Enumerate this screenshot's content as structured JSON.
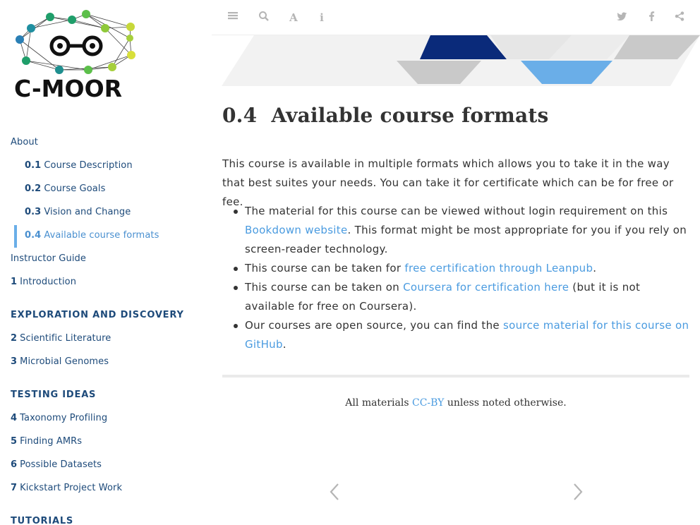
{
  "sidebar": {
    "logo_text": "C-MOOR",
    "items": [
      {
        "num": "",
        "label": "About"
      },
      {
        "num": "0.1",
        "label": "Course Description"
      },
      {
        "num": "0.2",
        "label": "Course Goals"
      },
      {
        "num": "0.3",
        "label": "Vision and Change"
      },
      {
        "num": "0.4",
        "label": "Available course formats"
      },
      {
        "num": "",
        "label": "Instructor Guide"
      },
      {
        "num": "1",
        "label": "Introduction"
      },
      {
        "num": "2",
        "label": "Scientific Literature"
      },
      {
        "num": "3",
        "label": "Microbial Genomes"
      },
      {
        "num": "4",
        "label": "Taxonomy Profiling"
      },
      {
        "num": "5",
        "label": "Finding AMRs"
      },
      {
        "num": "6",
        "label": "Possible Datasets"
      },
      {
        "num": "7",
        "label": "Kickstart Project Work"
      }
    ],
    "headers": [
      "EXPLORATION AND DISCOVERY",
      "TESTING IDEAS",
      "TUTORIALS"
    ]
  },
  "toolbar": {
    "left_icons": [
      "menu-icon",
      "search-icon",
      "font-icon",
      "info-icon"
    ],
    "right_icons": [
      "twitter-icon",
      "facebook-icon",
      "share-icon"
    ]
  },
  "main": {
    "section_number": "0.4",
    "section_title": "Available course formats",
    "intro": "This course is available in multiple formats which allows you to take it in the way that best suites your needs. You can take it for certificate which can be for free or fee.",
    "bullets": [
      {
        "pre": "The material for this course can be viewed without login requirement on this ",
        "link": "Bookdown website",
        "post": ". This format might be most appropriate for you if you rely on screen-reader technology."
      },
      {
        "pre": "This course can be taken for ",
        "link": "free certification through Leanpub",
        "post": "."
      },
      {
        "pre": "This course can be taken on ",
        "link": "Coursera for certification here",
        "post": " (but it is not available for free on Coursera)."
      },
      {
        "pre": "Our courses are open source, you can find the ",
        "link": "source material for this course on GitHub",
        "post": "."
      }
    ],
    "footer": {
      "pre": "All materials ",
      "link": "CC-BY",
      "post": " unless noted otherwise."
    }
  },
  "colors": {
    "nav": "#1d4a7a",
    "active": "#4a90d0",
    "link": "#4a9be0",
    "banner_dark": "#0a2a7a",
    "banner_light": "#6aaee8"
  }
}
